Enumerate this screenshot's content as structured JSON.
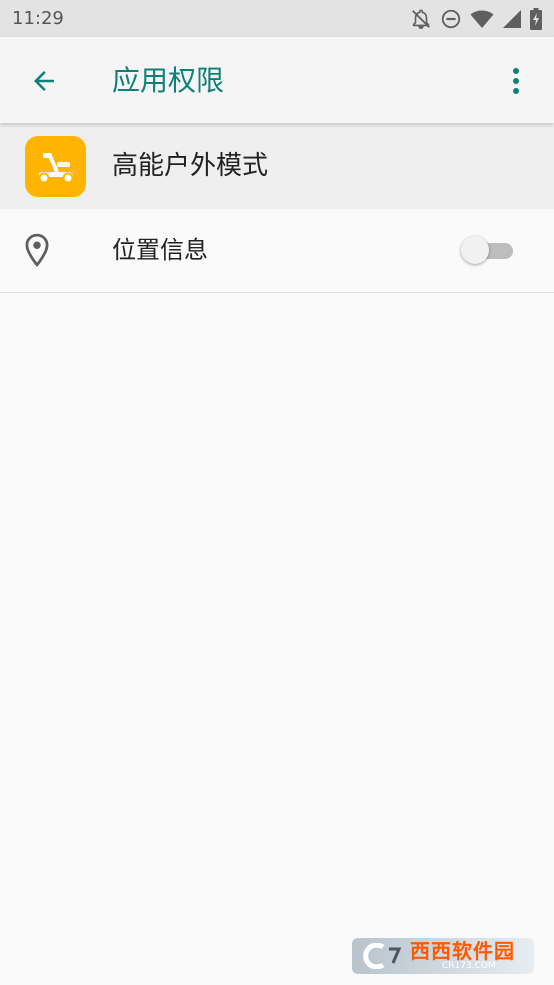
{
  "status_bar": {
    "time": "11:29",
    "icons": [
      "bell-off-icon",
      "do-not-disturb-icon",
      "wifi-icon",
      "signal-icon",
      "battery-charging-icon"
    ]
  },
  "app_bar": {
    "title": "应用权限",
    "back_icon": "arrow-back-icon",
    "overflow_icon": "more-vert-icon",
    "title_color": "#0f7f78"
  },
  "app_header": {
    "app_name": "高能户外模式",
    "icon": "scooter-icon",
    "icon_bg": "#ffb400"
  },
  "permissions": [
    {
      "label": "位置信息",
      "icon": "location-pin-icon",
      "enabled": false
    }
  ],
  "watermark": {
    "text": "西西软件园",
    "domain": "CR173.COM"
  }
}
